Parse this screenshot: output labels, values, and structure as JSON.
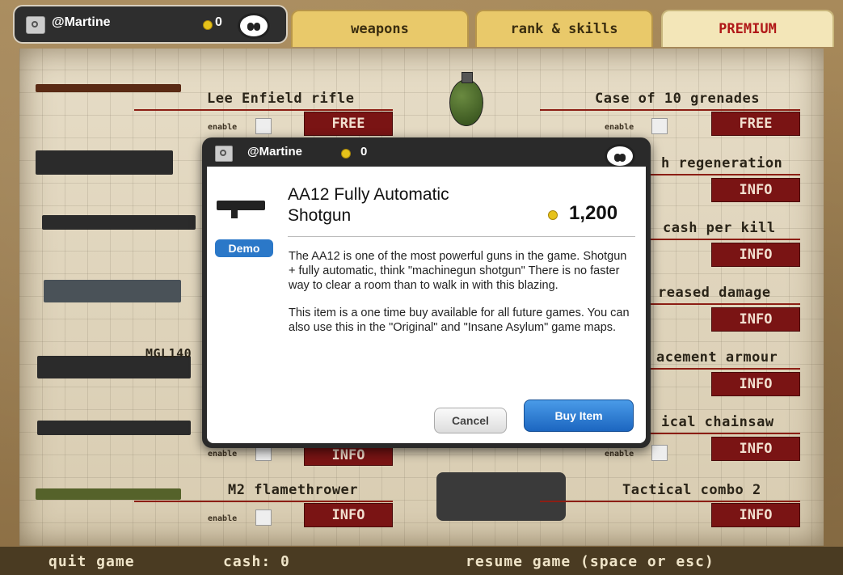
{
  "user": {
    "name": "@Martine",
    "coins": "0"
  },
  "tabs": {
    "weapons": "weapons",
    "rank": "rank & skills",
    "premium": "PREMIUM"
  },
  "items": {
    "enable_label": "enable",
    "left": [
      {
        "label": "Lee Enfield rifle",
        "button": "FREE"
      },
      {
        "label": "MGL140",
        "button": ""
      },
      {
        "label": "",
        "button": "INFO"
      },
      {
        "label": "M2 flamethrower",
        "button": "INFO"
      }
    ],
    "right": [
      {
        "label": "Case of 10 grenades",
        "button": "FREE"
      },
      {
        "label": "h regeneration",
        "button": "INFO"
      },
      {
        "label": "cash per kill",
        "button": "INFO"
      },
      {
        "label": "reased damage",
        "button": "INFO"
      },
      {
        "label": "acement armour",
        "button": "INFO"
      },
      {
        "label": "ical chainsaw",
        "button": "INFO"
      },
      {
        "label": "Tactical combo 2",
        "button": "INFO"
      }
    ]
  },
  "footer": {
    "quit": "quit game",
    "cash": "cash: 0",
    "resume": "resume game (space or esc)"
  },
  "dialog": {
    "user": "@Martine",
    "coins": "0",
    "title": "AA12 Fully Automatic Shotgun",
    "price": "1,200",
    "demo": "Demo",
    "description_1": "The AA12 is one of the most powerful guns in the game. Shotgun + fully automatic, think \"machinegun shotgun\" There is no faster way to clear a room than to walk in with this blazing.",
    "description_2": "This item is a one time buy available for all future games. You can also use this in the \"Original\" and \"Insane Asylum\" game maps.",
    "cancel": "Cancel",
    "buy": "Buy Item"
  }
}
